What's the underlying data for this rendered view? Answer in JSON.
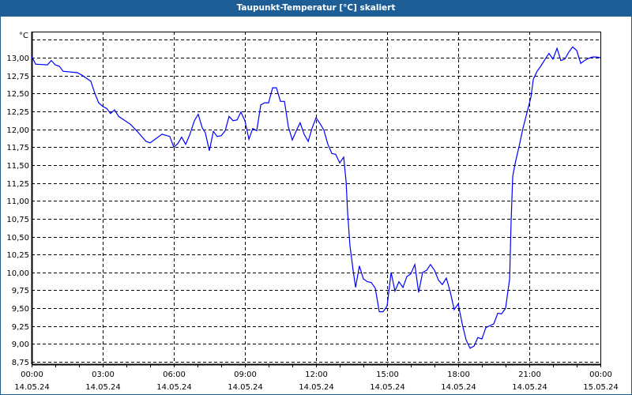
{
  "window": {
    "title": "Taupunkt-Temperatur [°C] skaliert"
  },
  "colors": {
    "titlebar": "#1d5e96",
    "series": "#0000ff",
    "grid": "#000000"
  },
  "chart_data": {
    "type": "line",
    "title": "Taupunkt-Temperatur [°C] skaliert",
    "ylabel": "°C",
    "xlabel": "",
    "ylim": [
      8.75,
      13.25
    ],
    "xlim_hours": [
      0,
      24
    ],
    "yticks": [
      "13,00",
      "12,75",
      "12,50",
      "12,25",
      "12,00",
      "11,75",
      "11,50",
      "11,25",
      "11,00",
      "10,75",
      "10,50",
      "10,25",
      "10,00",
      "9,75",
      "9,50",
      "9,25",
      "9,00",
      "8,75"
    ],
    "ytick_values": [
      13,
      12.75,
      12.5,
      12.25,
      12,
      11.75,
      11.5,
      11.25,
      11,
      10.75,
      10.5,
      10.25,
      10,
      9.75,
      9.5,
      9.25,
      9,
      8.75
    ],
    "xticks": [
      {
        "hours": 0,
        "time": "00:00",
        "date": "14.05.24"
      },
      {
        "hours": 3,
        "time": "03:00",
        "date": "14.05.24"
      },
      {
        "hours": 6,
        "time": "06:00",
        "date": "14.05.24"
      },
      {
        "hours": 9,
        "time": "09:00",
        "date": "14.05.24"
      },
      {
        "hours": 12,
        "time": "12:00",
        "date": "14.05.24"
      },
      {
        "hours": 15,
        "time": "15:00",
        "date": "14.05.24"
      },
      {
        "hours": 18,
        "time": "18:00",
        "date": "14.05.24"
      },
      {
        "hours": 21,
        "time": "21:00",
        "date": "14.05.24"
      },
      {
        "hours": 24,
        "time": "00:00",
        "date": "15.05.24"
      }
    ],
    "grid": true,
    "series": [
      {
        "name": "Taupunkt-Temperatur",
        "x_hours": [
          0,
          0.17,
          0.67,
          0.83,
          1.0,
          1.17,
          1.33,
          1.93,
          2.1,
          2.5,
          2.67,
          2.83,
          3.0,
          3.17,
          3.33,
          3.5,
          3.67,
          4.17,
          4.43,
          4.83,
          5.0,
          5.5,
          5.83,
          6.0,
          6.17,
          6.33,
          6.5,
          6.67,
          6.87,
          7.03,
          7.2,
          7.33,
          7.5,
          7.67,
          7.83,
          8.0,
          8.17,
          8.33,
          8.5,
          8.67,
          8.83,
          9.0,
          9.17,
          9.33,
          9.5,
          9.67,
          9.83,
          10.0,
          10.17,
          10.33,
          10.5,
          10.67,
          10.83,
          11.0,
          11.17,
          11.33,
          11.5,
          11.67,
          11.83,
          12.0,
          12.17,
          12.33,
          12.5,
          12.67,
          12.83,
          13.0,
          13.17,
          13.2,
          13.27,
          13.33,
          13.43,
          13.57,
          13.67,
          13.83,
          14.0,
          14.17,
          14.33,
          14.5,
          14.67,
          14.83,
          15.0,
          15.17,
          15.33,
          15.5,
          15.67,
          15.83,
          16.0,
          16.17,
          16.33,
          16.5,
          16.67,
          16.83,
          17.0,
          17.17,
          17.33,
          17.5,
          17.67,
          17.83,
          18.0,
          18.17,
          18.33,
          18.5,
          18.67,
          18.83,
          19.0,
          19.17,
          19.5,
          19.67,
          19.83,
          20.0,
          20.17,
          20.23,
          20.3,
          20.4,
          20.57,
          20.73,
          20.9,
          21.07,
          21.17,
          21.33,
          21.5,
          21.67,
          21.83,
          22.0,
          22.17,
          22.33,
          22.5,
          22.67,
          22.83,
          23.0,
          23.17,
          23.33,
          23.5,
          23.67,
          23.83,
          24.0
        ],
        "values": [
          13.02,
          12.91,
          12.9,
          12.96,
          12.9,
          12.88,
          12.81,
          12.79,
          12.76,
          12.67,
          12.5,
          12.37,
          12.32,
          12.29,
          12.22,
          12.27,
          12.18,
          12.07,
          11.98,
          11.83,
          11.81,
          11.93,
          11.9,
          11.75,
          11.8,
          11.89,
          11.79,
          11.92,
          12.12,
          12.21,
          12.02,
          11.95,
          11.7,
          11.97,
          11.9,
          11.91,
          11.98,
          12.18,
          12.12,
          12.13,
          12.24,
          12.12,
          11.86,
          12.01,
          11.98,
          12.34,
          12.37,
          12.37,
          12.58,
          12.58,
          12.39,
          12.39,
          12.04,
          11.85,
          11.98,
          12.09,
          11.93,
          11.83,
          12.01,
          12.16,
          12.08,
          11.99,
          11.79,
          11.66,
          11.65,
          11.53,
          11.61,
          11.5,
          11.27,
          10.86,
          10.38,
          10.02,
          9.79,
          10.09,
          9.91,
          9.87,
          9.86,
          9.78,
          9.45,
          9.45,
          9.53,
          10.0,
          9.74,
          9.87,
          9.79,
          9.94,
          9.98,
          10.11,
          9.72,
          10.0,
          10.03,
          10.11,
          10.03,
          9.89,
          9.83,
          9.92,
          9.72,
          9.48,
          9.56,
          9.28,
          9.06,
          8.94,
          8.97,
          9.09,
          9.07,
          9.23,
          9.28,
          9.43,
          9.42,
          9.5,
          9.91,
          10.68,
          11.34,
          11.52,
          11.76,
          12.01,
          12.23,
          12.45,
          12.7,
          12.81,
          12.89,
          12.98,
          13.06,
          12.98,
          13.13,
          12.96,
          12.98,
          13.08,
          13.15,
          13.1,
          12.92,
          12.96,
          12.99,
          13.01,
          13.01,
          13.0
        ]
      }
    ]
  }
}
